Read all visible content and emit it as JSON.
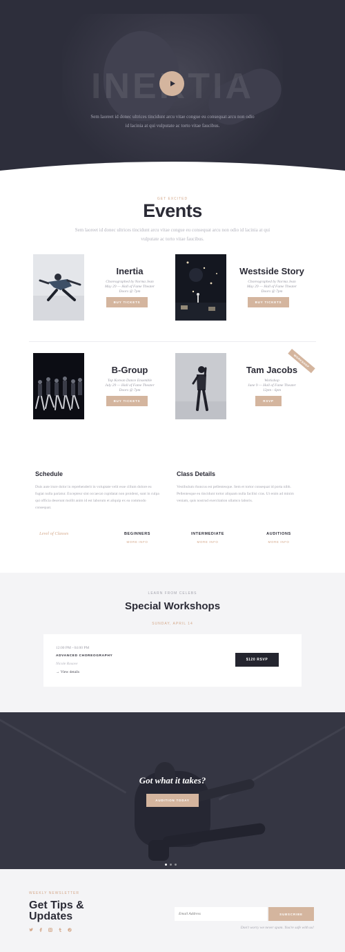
{
  "hero": {
    "title": "INERTIA",
    "description": "Sem laoreet id donec ultrices tincidunt arcu vitae congue eu consequat arcu non odio id lacinia at qui vulputate ac torto vitae faucibus.",
    "play_icon": "play-icon"
  },
  "events": {
    "eyebrow": "GET EXCITED",
    "title": "Events",
    "description": "Sem laoreet id donec ultrices tincidunt arcu vitae congue eu consequat arcu non odio id lacinia at qui vulputate ac torto vitae faucibus.",
    "items": [
      {
        "name": "Inertia",
        "line1": "Choreographed by Norma Jean",
        "line2": "May 29 — Hall of Fame Theater",
        "line3": "Doors @ 7pm",
        "button": "BUY TICKETS"
      },
      {
        "name": "Westside Story",
        "line1": "Choreographed by Norma Jean",
        "line2": "May 29 — Hall of Fame Theater",
        "line3": "Doors @ 7pm",
        "button": "BUY TICKETS"
      },
      {
        "name": "B-Group",
        "line1": "Top Korean Dance Ensemble",
        "line2": "July 29 — Hall of Fame Theater",
        "line3": "Doors @ 7pm",
        "button": "BUY TICKETS"
      },
      {
        "name": "Tam Jacobs",
        "line1": "Workshop",
        "line2": "June 9 — Hall of Fame Theater",
        "line3": "12pm - 6pm",
        "button": "RSVP",
        "ribbon": "WORKSHOP"
      }
    ]
  },
  "schedule": {
    "title": "Schedule",
    "body": "Duis aute irure dolor in reprehenderit in voluptate velit esse cillum dolore eu fugiat nulla pariatur. Excepteur sint occaecat cupidatat non proident, sunt in culpa qui officia deserunt mollit anim id est laborum et aliquip ex ea commodo consequat."
  },
  "class_details": {
    "title": "Class Details",
    "body": "Vestibulum rhoncus est pellentesque. Sem et tortor consequat id porta nibh. Pellentesque eu tincidunt tortor aliquam nulla facilisi cras. Ut enim ad minim veniam, quis nostrud exercitation ullamco laboris."
  },
  "levels": {
    "label": "Level of Classes",
    "items": [
      {
        "name": "BEGINNERS",
        "link": "MORE INFO"
      },
      {
        "name": "INTERMEDIATE",
        "link": "MORE INFO"
      },
      {
        "name": "AUDITIONS",
        "link": "MORE INFO"
      }
    ]
  },
  "workshops": {
    "eyebrow": "LEARN FROM CELEBS",
    "title": "Special Workshops",
    "date": "SUNDAY, APRIL 14",
    "card": {
      "time": "12:00 PM - 04:00 PM",
      "name": "ADVANCED CHOREOGRAPHY",
      "teacher": "Nicole Rosove",
      "details": "→  View details",
      "button": "$120 RSVP"
    }
  },
  "cta": {
    "title": "Got what it takes?",
    "button": "AUDITION TODAY"
  },
  "newsletter": {
    "eyebrow": "WEEKLY NEWSLETTER",
    "title": "Get Tips & Updates",
    "email_placeholder": "Email Address",
    "button": "SUBSCRIBE",
    "note": "Don't worry we never spam. You're safe with us!",
    "socials": [
      "twitter-icon",
      "facebook-icon",
      "instagram-icon",
      "tumblr-icon",
      "pinterest-icon"
    ]
  },
  "colors": {
    "accent": "#d4b59e",
    "dark": "#2d2e3b",
    "light_bg": "#f4f4f6"
  }
}
